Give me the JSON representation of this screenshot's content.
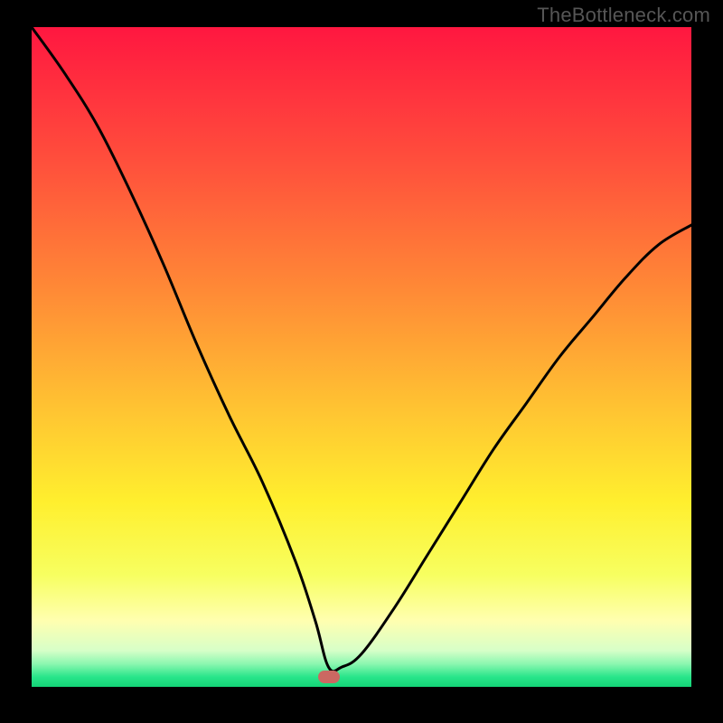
{
  "watermark": "TheBottleneck.com",
  "colors": {
    "frame_bg": "#000000",
    "curve": "#000000",
    "marker": "#cb6862",
    "gradient_stops": [
      {
        "offset": 0.0,
        "color": "#ff1740"
      },
      {
        "offset": 0.2,
        "color": "#ff4e3c"
      },
      {
        "offset": 0.4,
        "color": "#ff8a36"
      },
      {
        "offset": 0.58,
        "color": "#ffc432"
      },
      {
        "offset": 0.72,
        "color": "#ffef2e"
      },
      {
        "offset": 0.83,
        "color": "#f7ff60"
      },
      {
        "offset": 0.9,
        "color": "#ffffb0"
      },
      {
        "offset": 0.945,
        "color": "#d7ffc8"
      },
      {
        "offset": 0.965,
        "color": "#8cf7b0"
      },
      {
        "offset": 0.985,
        "color": "#28e58a"
      },
      {
        "offset": 1.0,
        "color": "#14d477"
      }
    ]
  },
  "chart_data": {
    "type": "line",
    "title": "",
    "xlabel": "",
    "ylabel": "",
    "xlim": [
      0,
      100
    ],
    "ylim": [
      0,
      100
    ],
    "grid": false,
    "annotations": [
      {
        "x": 45,
        "y": 1.5,
        "kind": "marker",
        "shape": "rounded-rect",
        "color": "#cb6862"
      }
    ],
    "series": [
      {
        "name": "bottleneck-curve",
        "x": [
          0,
          5,
          10,
          15,
          20,
          25,
          30,
          35,
          40,
          43,
          45,
          47,
          50,
          55,
          60,
          65,
          70,
          75,
          80,
          85,
          90,
          95,
          100
        ],
        "values": [
          100,
          93,
          85,
          75,
          64,
          52,
          41,
          31,
          19,
          10,
          3,
          3,
          5,
          12,
          20,
          28,
          36,
          43,
          50,
          56,
          62,
          67,
          70
        ]
      }
    ]
  }
}
